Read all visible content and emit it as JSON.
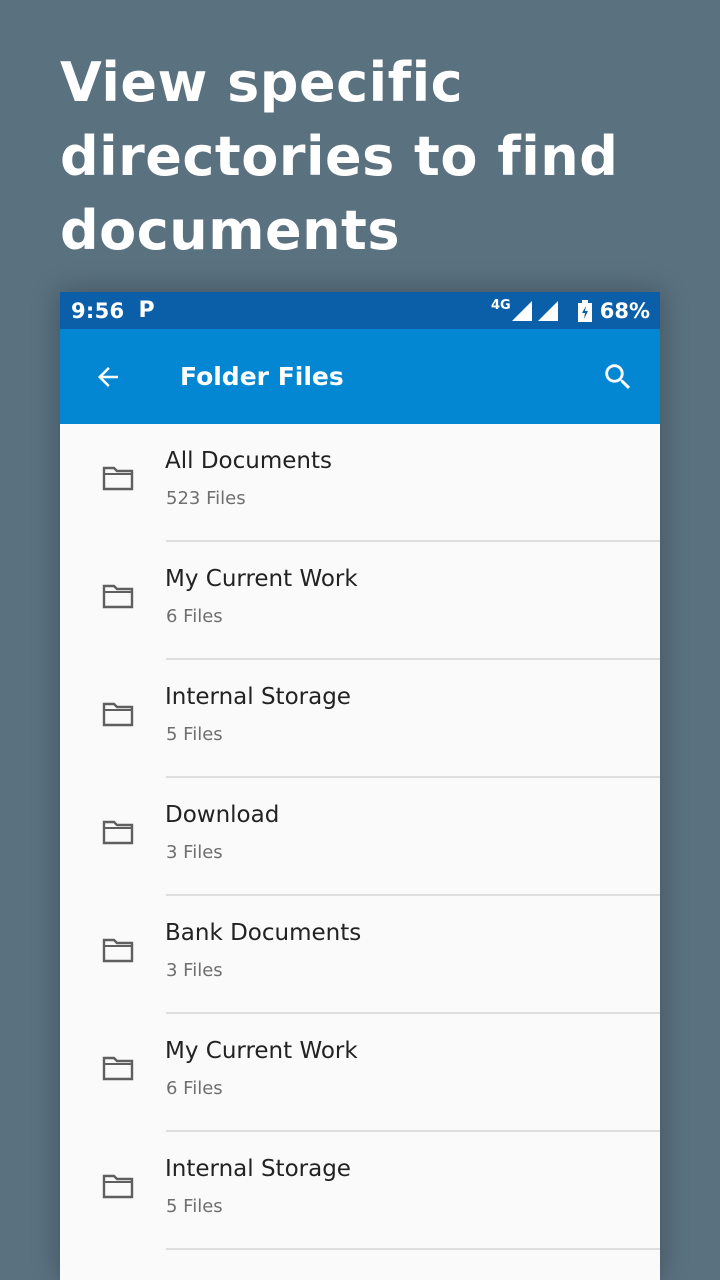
{
  "headline": "View specific directories to find documents",
  "status_bar": {
    "time": "9:56",
    "notification": "P",
    "network": "4G",
    "battery": "68%"
  },
  "app_bar": {
    "title": "Folder Files",
    "back_icon": "arrow-back-icon",
    "search_icon": "search-icon"
  },
  "colors": {
    "background": "#5a7180",
    "status_bar": "#0a5fa8",
    "app_bar": "#0387d2",
    "list_background": "#fafafa"
  },
  "folders": [
    {
      "name": "All Documents",
      "count": "523 Files"
    },
    {
      "name": "My Current Work",
      "count": "6 Files"
    },
    {
      "name": "Internal Storage",
      "count": "5 Files"
    },
    {
      "name": "Download",
      "count": "3 Files"
    },
    {
      "name": "Bank Documents",
      "count": "3 Files"
    },
    {
      "name": "My Current Work",
      "count": "6 Files"
    },
    {
      "name": "Internal Storage",
      "count": "5 Files"
    }
  ]
}
